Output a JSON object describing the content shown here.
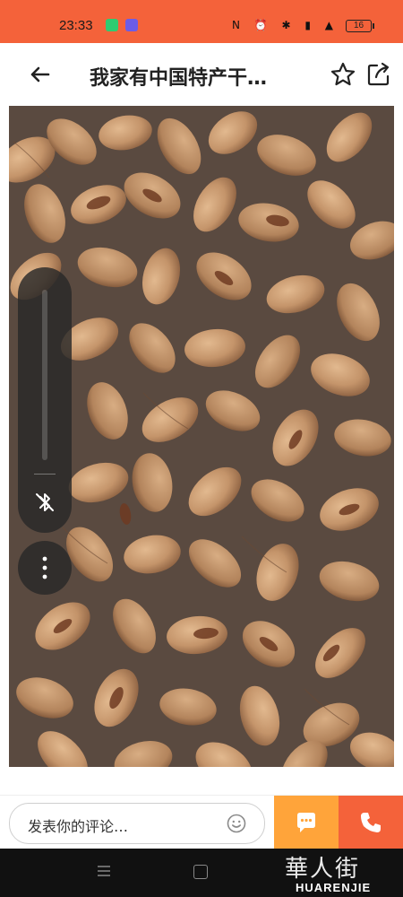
{
  "status_bar": {
    "time": "23:33",
    "battery_level": "16",
    "icons": [
      "nfc-icon",
      "alarm-icon",
      "bluetooth-icon",
      "volte-icon",
      "5g-signal-icon",
      "battery-icon"
    ]
  },
  "header": {
    "title": "我家有中国特产干…",
    "icons": [
      "back-arrow-icon",
      "star-icon",
      "share-icon"
    ]
  },
  "photo": {
    "subject": "pecans"
  },
  "volume_overlay": {
    "level": 0,
    "icons": [
      "bluetooth-off-icon",
      "more-vertical-icon"
    ]
  },
  "bottom_bar": {
    "comment_placeholder": "发表你的评论…",
    "icons": [
      "smile-icon",
      "chat-bubble-icon",
      "phone-icon"
    ],
    "colors": {
      "chat": "#ffa43a",
      "phone": "#f4623a"
    }
  },
  "watermark": {
    "text_cn": "華人街",
    "text_en": "HUARENJIE"
  },
  "colors": {
    "status_bar": "#f4623a",
    "accent": "#f4623a"
  }
}
